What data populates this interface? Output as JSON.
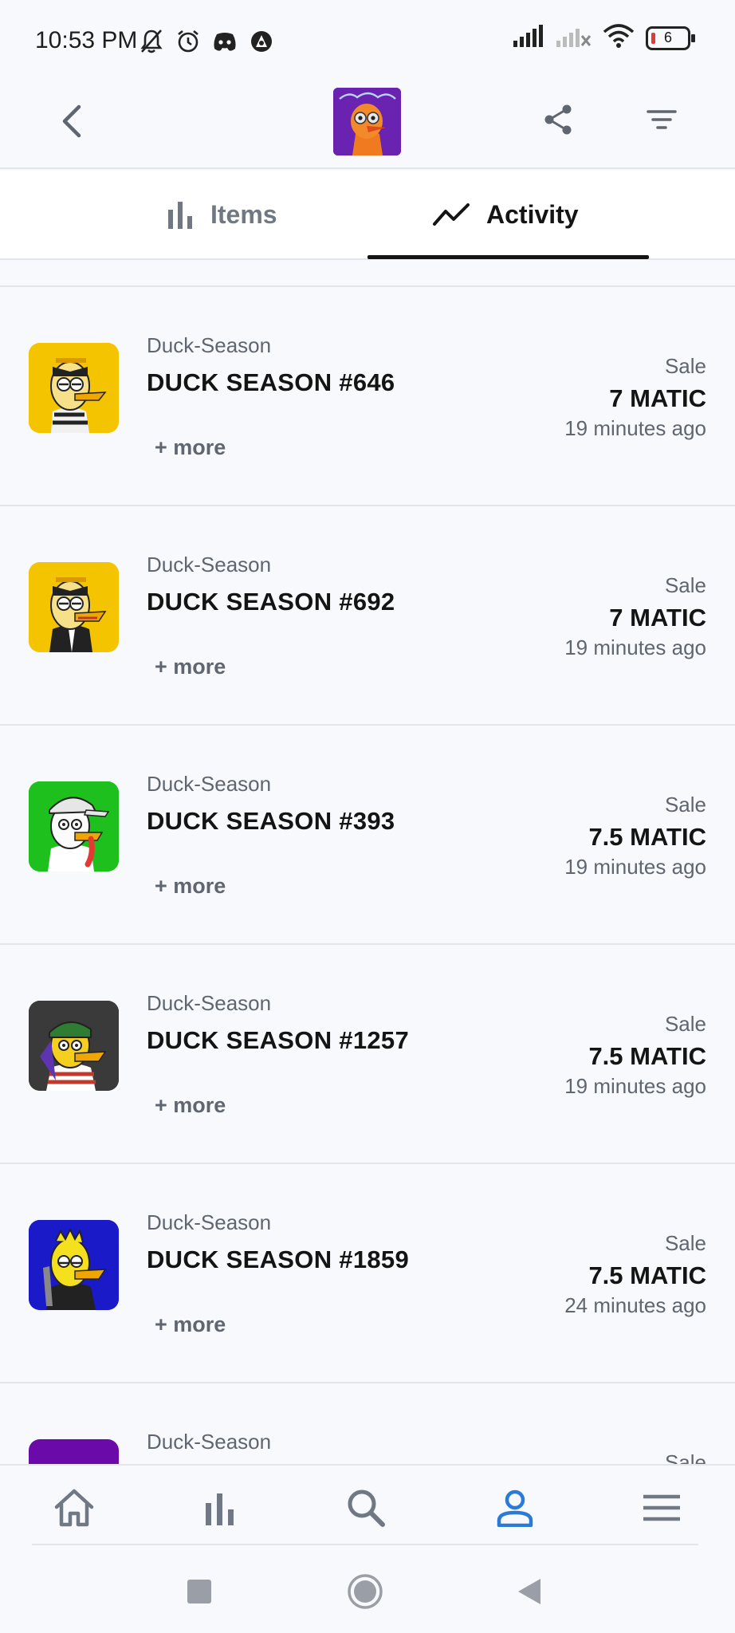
{
  "status_bar": {
    "time": "10:53 PM",
    "battery_level": "6",
    "icons_left": [
      "mute-icon",
      "alarm-icon",
      "discord-icon",
      "vpn-icon"
    ],
    "icons_right": [
      "signal-icon",
      "signal-off-icon",
      "wifi-icon",
      "battery-icon"
    ]
  },
  "app_bar": {
    "back_icon": "chevron-left-icon",
    "share_icon": "share-icon",
    "filter_icon": "filter-icon"
  },
  "tabs": [
    {
      "label": "Items",
      "icon": "bar-chart-icon",
      "active": false
    },
    {
      "label": "Activity",
      "icon": "trend-line-icon",
      "active": true
    }
  ],
  "activity": [
    {
      "collection": "Duck-Season",
      "name": "DUCK SEASON #646",
      "more": "+ more",
      "type": "Sale",
      "price": "7 MATIC",
      "time": "19 minutes ago",
      "bg": "#f5c400"
    },
    {
      "collection": "Duck-Season",
      "name": "DUCK SEASON #692",
      "more": "+ more",
      "type": "Sale",
      "price": "7 MATIC",
      "time": "19 minutes ago",
      "bg": "#f5c400"
    },
    {
      "collection": "Duck-Season",
      "name": "DUCK SEASON #393",
      "more": "+ more",
      "type": "Sale",
      "price": "7.5 MATIC",
      "time": "19 minutes ago",
      "bg": "#1ec01e"
    },
    {
      "collection": "Duck-Season",
      "name": "DUCK SEASON #1257",
      "more": "+ more",
      "type": "Sale",
      "price": "7.5 MATIC",
      "time": "19 minutes ago",
      "bg": "#3a3a3a"
    },
    {
      "collection": "Duck-Season",
      "name": "DUCK SEASON #1859",
      "more": "+ more",
      "type": "Sale",
      "price": "7.5 MATIC",
      "time": "24 minutes ago",
      "bg": "#1a1ac8"
    },
    {
      "collection": "Duck-Season",
      "name": "",
      "more": "",
      "type": "Sale",
      "price": "",
      "time": "",
      "bg": "#6a0aa8"
    }
  ],
  "bottom_nav": [
    {
      "icon": "home-icon",
      "active": false
    },
    {
      "icon": "stats-icon",
      "active": false
    },
    {
      "icon": "search-icon",
      "active": false
    },
    {
      "icon": "profile-icon",
      "active": true
    },
    {
      "icon": "menu-icon",
      "active": false
    }
  ],
  "colors": {
    "accent": "#2b7bd6",
    "text": "#141414",
    "muted": "#5f6670",
    "divider": "#e3e5ea"
  }
}
